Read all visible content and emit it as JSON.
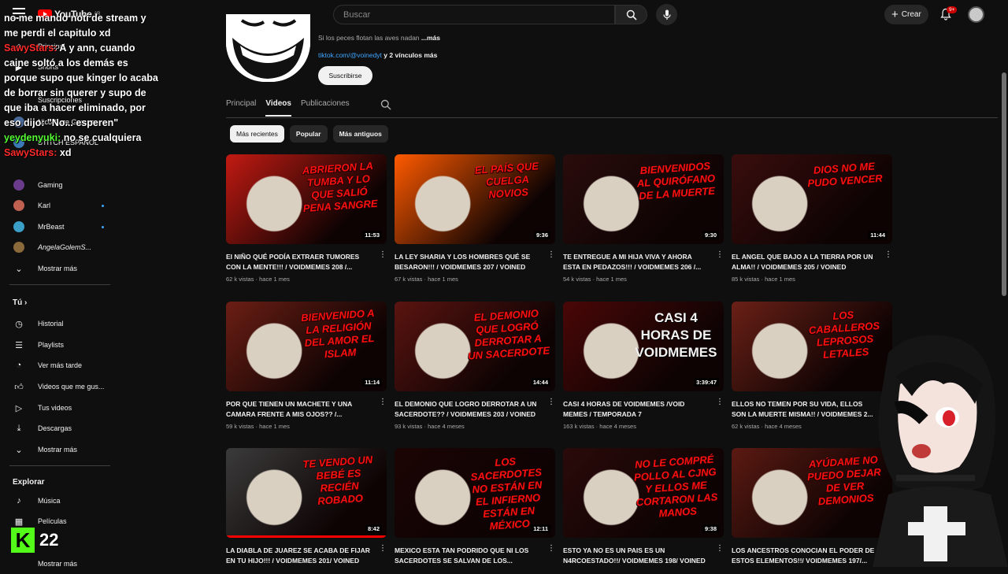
{
  "header": {
    "logo_text": "YouTube",
    "logo_region": "AR",
    "search_placeholder": "Buscar",
    "create_label": "Crear",
    "notifications_badge": "9+"
  },
  "sidebar": {
    "items": [
      {
        "label": "Principal"
      },
      {
        "label": "Shorts"
      },
      {
        "label": "Suscripciones"
      },
      {
        "label": "Nico Core Games"
      },
      {
        "label": "STITCH ESPAÑOL"
      },
      {
        "label": "Gaming"
      },
      {
        "label": "Karl"
      },
      {
        "label": "MrBeast"
      },
      {
        "label": "AngelaGolemS..."
      },
      {
        "label": "Mostrar más"
      }
    ],
    "you_heading": "Tú",
    "you_items": [
      {
        "label": "Historial"
      },
      {
        "label": "Playlists"
      },
      {
        "label": "Ver más tarde"
      },
      {
        "label": "Videos que me gus..."
      },
      {
        "label": "Tus videos"
      },
      {
        "label": "Descargas"
      },
      {
        "label": "Mostrar más"
      }
    ],
    "explore_heading": "Explorar",
    "explore_items": [
      {
        "label": "Música"
      },
      {
        "label": "Películas"
      },
      {
        "label": "Mostrar más"
      }
    ]
  },
  "channel": {
    "description": "Si los peces flotan las aves nadan",
    "description_more": "...más",
    "link_url": "tiktok.com/@voinedyt",
    "link_more": "y 2 vínculos más",
    "subscribe_label": "Suscribirse",
    "tabs": [
      "Principal",
      "Videos",
      "Publicaciones"
    ],
    "active_tab": "Videos"
  },
  "chips": [
    "Más recientes",
    "Popular",
    "Más antiguos"
  ],
  "videos": [
    {
      "title": "EI NIÑO QUÉ PODÍA EXTRAER TUMORES CON LA MENTE!!! / VOIDMEMES 208 /...",
      "meta": "62 k vistas · hace 1 mes",
      "duration": "11:53",
      "thumb_text": "Abrieron la tumba y lo que salió pena sangre",
      "accent": "#c21a12"
    },
    {
      "title": "LA LEY SHARIA Y LOS HOMBRES QUÉ SE BESARON!!! / VOIDMEMES 207 / VOINED",
      "meta": "67 k vistas · hace 1 mes",
      "duration": "9:36",
      "thumb_text": "El país que cuelga novios",
      "accent": "#ff5a00"
    },
    {
      "title": "TE ENTREGUE A MI HIJA VIVA Y AHORA ESTA EN PEDAZOS!!! / VOIDMEMES 206 /...",
      "meta": "54 k vistas · hace 1 mes",
      "duration": "9:30",
      "thumb_text": "Bienvenidos al quirófano de la muerte",
      "accent": "#2a0c0c"
    },
    {
      "title": "EL ANGEL QUE BAJO A LA TIERRA POR UN ALMA!! / VOIDMEMES 205 / VOINED",
      "meta": "85 k vistas · hace 1 mes",
      "duration": "11:44",
      "thumb_text": "Dios no me pudo vencer",
      "accent": "#3a0d0d"
    },
    {
      "title": "POR QUE TIENEN UN MACHETE Y UNA CAMARA FRENTE A MIS OJOS?? /...",
      "meta": "59 k vistas · hace 1 mes",
      "duration": "11:14",
      "thumb_text": "Bienvenido a la religión del amor el islam",
      "accent": "#6b1e14"
    },
    {
      "title": "EL DEMONIO QUE LOGRO DERROTAR A UN SACERDOTE?? / VOIDMEMES 203 / VOINED",
      "meta": "93 k vistas · hace 4 meses",
      "duration": "14:44",
      "thumb_text": "El demonio que logró derrotar a un sacerdote",
      "accent": "#5a1410"
    },
    {
      "title": "CASI 4 HORAS DE VOIDMEMES /VOID MEMES / TEMPORADA 7",
      "meta": "163 k vistas · hace 4 meses",
      "duration": "3:39:47",
      "thumb_text": "Casi 4 horas de voidmemes",
      "accent": "#4a0707"
    },
    {
      "title": "ELLOS NO TEMEN POR SU VIDA, ELLOS SON LA MUERTE MISMA!! / VOIDMEMES 2...",
      "meta": "62 k vistas · hace 4 meses",
      "duration": "",
      "thumb_text": "Los caballeros leprosos letales",
      "accent": "#6a2016"
    },
    {
      "title": "LA DIABLA DE JUAREZ SE ACABA DE FIJAR EN TU HIJO!!! / VOIDMEMES 201/ VOINED",
      "meta": "",
      "duration": "8:42",
      "thumb_text": "Te vendo un bebé es recién robado",
      "accent": "#3b3b3b"
    },
    {
      "title": "MEXICO ESTA TAN PODRIDO QUE NI LOS SACERDOTES SE SALVAN DE LOS...",
      "meta": "",
      "duration": "12:11",
      "thumb_text": "Los sacerdotes no están en el infierno están en México",
      "accent": "#1c0404"
    },
    {
      "title": "ESTO YA NO ES UN PAIS ES UN N4RCOESTADO!!/ VOIDMEMES 198/ VOINED",
      "meta": "",
      "duration": "9:38",
      "thumb_text": "No le compré pollo al CJNG y ellos me cortaron las manos",
      "accent": "#2b0a0a"
    },
    {
      "title": "LOS ANCESTROS CONOCIAN EL PODER DE ESTOS ELEMENTOS!!/ VOIDMEMES 197/...",
      "meta": "",
      "duration": "",
      "thumb_text": "Ayúdame no puedo dejar de ver demonios",
      "accent": "#5b1a12"
    }
  ],
  "overlay": {
    "chat": [
      {
        "user": "",
        "text": "no me mando noti de stream y me perdi el capitulo xd"
      },
      {
        "user": "SawyStars:",
        "text": "A y ann, cuando caine soltó a los demás es porque supo que kinger lo acaba de borrar sin querer y supo de que iba a hacer eliminado, por eso dijo: \"No... esperen\""
      },
      {
        "user": "yeydenyuki:",
        "text": "no se cualquiera"
      },
      {
        "user": "SawyStars:",
        "text": "xd"
      }
    ],
    "kick_letter": "K",
    "kick_count": "22"
  }
}
